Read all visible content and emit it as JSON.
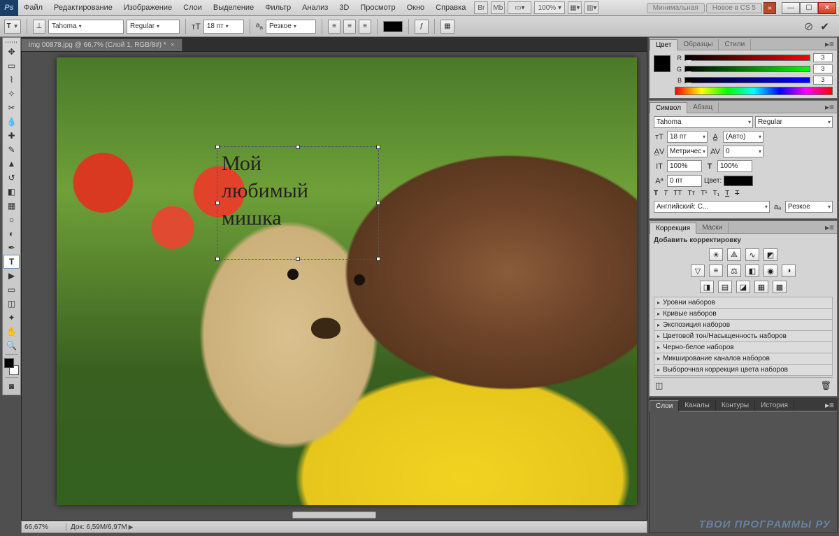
{
  "menubar": [
    "Файл",
    "Редактирование",
    "Изображение",
    "Слои",
    "Выделение",
    "Фильтр",
    "Анализ",
    "3D",
    "Просмотр",
    "Окно",
    "Справка"
  ],
  "title_extras": {
    "zoom": "100%",
    "workspace1": "Минимальная",
    "workspace2": "Новое в CS 5"
  },
  "options": {
    "tool_icon": "T",
    "font_family": "Tahoma",
    "font_style": "Regular",
    "size_label": "18 пт",
    "aa_label": "Резкое"
  },
  "document": {
    "tab_title": "img 00878.jpg @ 66,7% (Слой 1, RGB/8#) *",
    "text_content": "Мой\nлюбимый\nмишка"
  },
  "status": {
    "zoom": "66,67%",
    "doc": "Док: 6,59M/6,97M"
  },
  "panels": {
    "color": {
      "tabs": [
        "Цвет",
        "Образцы",
        "Стили"
      ],
      "r_label": "R",
      "g_label": "G",
      "b_label": "B",
      "r": "3",
      "g": "3",
      "b": "3"
    },
    "character": {
      "tabs": [
        "Символ",
        "Абзац"
      ],
      "font": "Tahoma",
      "style": "Regular",
      "size": "18 пт",
      "leading": "(Авто)",
      "kerning": "Метричес",
      "tracking": "0",
      "vscale": "100%",
      "hscale": "100%",
      "baseline": "0 пт",
      "color_label": "Цвет:",
      "lang": "Английский: С...",
      "aa": "Резкое"
    },
    "adjust": {
      "tabs": [
        "Коррекция",
        "Маски"
      ],
      "hint": "Добавить корректировку",
      "presets": [
        "Уровни наборов",
        "Кривые наборов",
        "Экспозиция наборов",
        "Цветовой тон/Насыщенность наборов",
        "Черно-белое наборов",
        "Микширование каналов наборов",
        "Выборочная коррекция цвета наборов"
      ]
    },
    "layers": {
      "tabs": [
        "Слои",
        "Каналы",
        "Контуры",
        "История"
      ]
    }
  },
  "watermark": "ТВОИ ПРОГРАММЫ РУ"
}
